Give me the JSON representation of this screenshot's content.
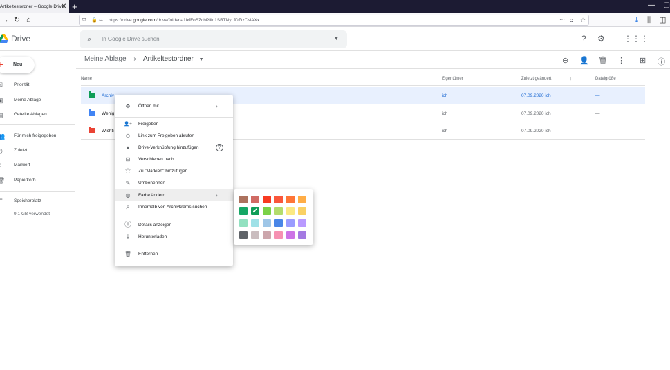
{
  "browser": {
    "tab_title": "Artikeltestordner – Google Drive",
    "tab_close": "✕",
    "new_tab": "+",
    "url_prefix": "https://drive.",
    "url_domain": "google.com",
    "url_rest": "/drive/folders/1lxfFoSZchPllld1SRTNyLfDZtzCsiAXx",
    "url_more": "···"
  },
  "header": {
    "app_name": "Drive",
    "search_placeholder": "In Google Drive suchen"
  },
  "sidebar": {
    "new_label": "Neu",
    "items": [
      {
        "label": "Priorität",
        "icon": "priority-icon",
        "glyph": "☑"
      },
      {
        "label": "Meine Ablage",
        "icon": "my-drive-icon",
        "glyph": "▣"
      },
      {
        "label": "Geteilte Ablagen",
        "icon": "shared-drives-icon",
        "glyph": "▤"
      },
      {
        "label": "Für mich freigegeben",
        "icon": "shared-with-me-icon",
        "glyph": "👥"
      },
      {
        "label": "Zuletzt",
        "icon": "recent-icon",
        "glyph": "◷"
      },
      {
        "label": "Markiert",
        "icon": "starred-icon",
        "glyph": "☆"
      },
      {
        "label": "Papierkorb",
        "icon": "trash-icon",
        "glyph": "🗑"
      },
      {
        "label": "Speicherplatz",
        "icon": "storage-icon",
        "glyph": "☰"
      }
    ],
    "storage_used": "9,1 GB verwendet"
  },
  "main": {
    "breadcrumb_root": "Meine Ablage",
    "breadcrumb_sep": "›",
    "breadcrumb_current": "Artikeltestordner",
    "columns": {
      "name": "Name",
      "owner": "Eigentümer",
      "modified": "Zuletzt geändert",
      "sort_arrow": "↓",
      "size": "Dateigröße"
    },
    "rows": [
      {
        "name": "Archiv",
        "owner": "ich",
        "modified": "07.09.2020 ich",
        "size": "—",
        "color": "#0f9d58",
        "selected": true
      },
      {
        "name": "Wenig",
        "owner": "ich",
        "modified": "07.09.2020 ich",
        "size": "—",
        "color": "#4285f4",
        "selected": false
      },
      {
        "name": "Wichti",
        "owner": "ich",
        "modified": "07.09.2020 ich",
        "size": "—",
        "color": "#ea4335",
        "selected": false
      }
    ]
  },
  "context_menu": {
    "items": [
      {
        "label": "Öffnen mit",
        "icon": "open-with-icon",
        "glyph": "✥",
        "submenu": true
      },
      {
        "label": "Freigeben",
        "icon": "share-icon",
        "glyph": "👤+"
      },
      {
        "label": "Link zum Freigeben abrufen",
        "icon": "link-icon",
        "glyph": "⊖"
      },
      {
        "label": "Drive-Verknüpfung hinzufügen",
        "icon": "add-shortcut-icon",
        "glyph": "▲",
        "help": "?"
      },
      {
        "label": "Verschieben nach",
        "icon": "move-icon",
        "glyph": "⊡"
      },
      {
        "label": "Zu \"Markiert\" hinzufügen",
        "icon": "star-icon",
        "glyph": "☆"
      },
      {
        "label": "Umbenennen",
        "icon": "rename-icon",
        "glyph": "✎"
      },
      {
        "label": "Farbe ändern",
        "icon": "palette-icon",
        "glyph": "◍",
        "submenu": true
      },
      {
        "label": "Innerhalb von Archivkrams suchen",
        "icon": "search-icon",
        "glyph": "⌕"
      },
      {
        "label": "Details anzeigen",
        "icon": "info-icon",
        "glyph": "ⓘ"
      },
      {
        "label": "Herunterladen",
        "icon": "download-icon",
        "glyph": "⤓"
      },
      {
        "label": "Entfernen",
        "icon": "trash-icon",
        "glyph": "🗑"
      }
    ],
    "submenu_arrow": "›"
  },
  "color_picker": {
    "check": "✓",
    "selected_index": 7,
    "swatches": [
      "#ac725e",
      "#d06b64",
      "#f83a22",
      "#fa573c",
      "#ff7537",
      "#ffad46",
      "#16a765",
      "#0f9d58",
      "#7bd148",
      "#b3dc6c",
      "#fbe983",
      "#fad165",
      "#92e1c0",
      "#9fe1e7",
      "#9fc6e7",
      "#4986e7",
      "#9a9cff",
      "#b99aff",
      "#5f6368",
      "#cabdbf",
      "#cca6ac",
      "#f691b2",
      "#cd74e6",
      "#a47ae2"
    ]
  }
}
